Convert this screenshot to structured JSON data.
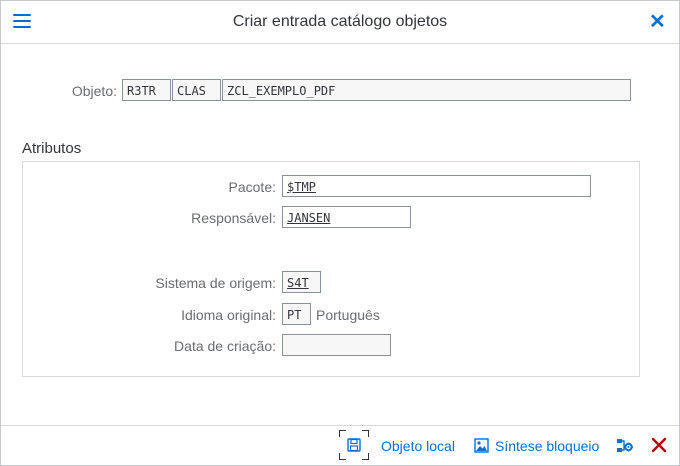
{
  "dialog": {
    "title": "Criar entrada catálogo objetos",
    "menu_icon": "hamburger-menu-icon",
    "close_icon": "close-icon"
  },
  "object": {
    "label": "Objeto:",
    "pgmid": "R3TR",
    "type": "CLAS",
    "name": "ZCL_EXEMPLO_PDF"
  },
  "attributes": {
    "section_title": "Atributos",
    "package_label": "Pacote:",
    "package_value": "$TMP",
    "owner_label": "Responsável:",
    "owner_value": "JANSEN",
    "source_system_label": "Sistema de origem:",
    "source_system_value": "S4T",
    "original_language_label": "Idioma original:",
    "original_language_code": "PT",
    "original_language_text": "Português",
    "creation_date_label": "Data de criação:",
    "creation_date_value": ""
  },
  "footer": {
    "save_icon": "save-icon",
    "local_object_label": "Objeto local",
    "lock_overview_icon": "image-icon",
    "lock_overview_label": "Síntese bloqueio",
    "extra_icon": "hierarchy-settings-icon",
    "cancel_icon": "cancel-icon"
  },
  "colors": {
    "accent": "#0a6ed1",
    "cancel": "#bb0000",
    "label": "#6a6d70",
    "text": "#32363a"
  }
}
